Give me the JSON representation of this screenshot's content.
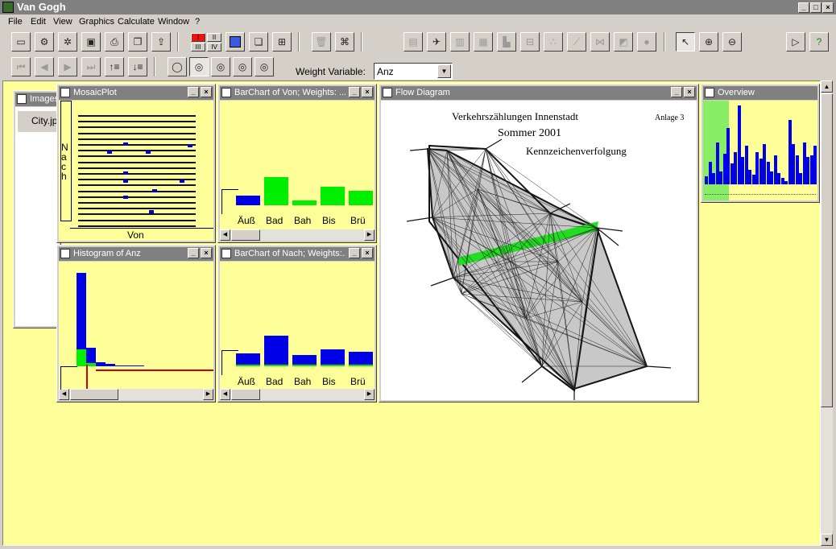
{
  "app": {
    "title": "Van Gogh"
  },
  "menu": [
    "File",
    "Edit",
    "View",
    "Graphics",
    "Calculate",
    "Window",
    "?"
  ],
  "toolbar": {
    "roman": [
      "I",
      "II",
      "III",
      "IV"
    ]
  },
  "weight": {
    "label": "Weight Variable:",
    "value": "Anz"
  },
  "windows": {
    "images": {
      "title": "Images",
      "item": "City.jpg"
    },
    "mosaic": {
      "title": "MosaicPlot",
      "ylabel": "N a c h",
      "xlabel": "Von"
    },
    "barvon": {
      "title": "BarChart of Von; Weights: ...",
      "categories": [
        "Äuß",
        "Bad",
        "Bah",
        "Bis",
        "Brü"
      ],
      "values": [
        12,
        35,
        6,
        23,
        18
      ],
      "highlight": [
        0,
        35,
        6,
        23,
        18
      ]
    },
    "barnach": {
      "title": "BarChart of Nach; Weights:...",
      "categories": [
        "Äuß",
        "Bad",
        "Bah",
        "Bis",
        "Brü"
      ],
      "values": [
        16,
        38,
        14,
        21,
        18
      ],
      "highlight": [
        2,
        2,
        2,
        2,
        2
      ]
    },
    "histogram": {
      "title": "Histogram of Anz",
      "values": [
        116,
        23,
        5,
        3,
        1,
        1,
        1
      ],
      "highlight": [
        21,
        4,
        0,
        0,
        0,
        0,
        0
      ]
    },
    "flow": {
      "title": "Flow Diagram",
      "map_title": "Verkehrszählungen Innenstadt",
      "map_note": "Anlage 3",
      "map_subtitle": "Sommer 2001",
      "map_caption": "Kennzeichenverfolgung"
    },
    "overview": {
      "title": "Overview"
    }
  },
  "colors": {
    "bar": "#0000e6",
    "highlight": "#00ee00",
    "plot_bg": "#ffff99",
    "red_line": "#cc0000"
  }
}
